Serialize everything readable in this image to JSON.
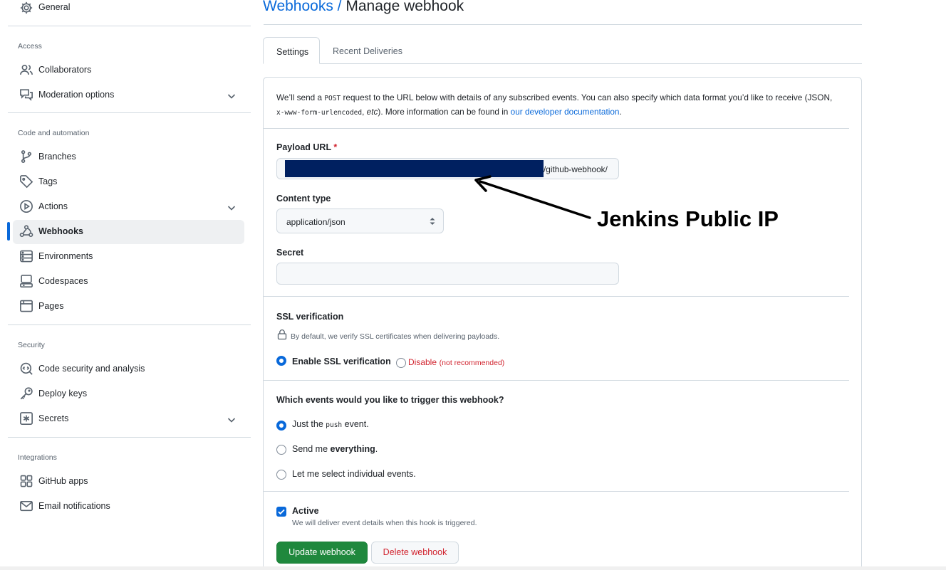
{
  "sidebar": {
    "general": "General",
    "access_heading": "Access",
    "collaborators": "Collaborators",
    "moderation": "Moderation options",
    "code_heading": "Code and automation",
    "branches": "Branches",
    "tags": "Tags",
    "actions": "Actions",
    "webhooks": "Webhooks",
    "environments": "Environments",
    "codespaces": "Codespaces",
    "pages": "Pages",
    "security_heading": "Security",
    "code_security": "Code security and analysis",
    "deploy_keys": "Deploy keys",
    "secrets": "Secrets",
    "integrations_heading": "Integrations",
    "github_apps": "GitHub apps",
    "email_notifications": "Email notifications"
  },
  "header": {
    "breadcrumb_link": "Webhooks",
    "separator": " / ",
    "title": "Manage webhook"
  },
  "tabs": {
    "settings": "Settings",
    "recent_deliveries": "Recent Deliveries"
  },
  "intro": {
    "part1": "We’ll send a ",
    "post": "POST",
    "part2": " request to the URL below with details of any subscribed events. You can also specify which data format you’d like to receive (JSON,",
    "urlencoded": "x-www-form-urlencoded",
    "comma": ", ",
    "etc": "etc",
    "part3": "). More information can be found in ",
    "doc_link": "our developer documentation",
    "period": "."
  },
  "payload": {
    "label": "Payload URL",
    "required_mark": "*",
    "visible_suffix": "/github-webhook/"
  },
  "annotation": {
    "text": "Jenkins Public IP"
  },
  "content_type": {
    "label": "Content type",
    "value": "application/json"
  },
  "secret": {
    "label": "Secret",
    "value": ""
  },
  "ssl": {
    "label": "SSL verification",
    "note": "By default, we verify SSL certificates when delivering payloads.",
    "enable": "Enable SSL verification",
    "disable": "Disable",
    "not_recommended": "(not recommended)"
  },
  "events": {
    "question": "Which events would you like to trigger this webhook?",
    "just_push_pre": "Just the ",
    "push": "push",
    "just_push_post": " event.",
    "send_me_pre": "Send me ",
    "everything": "everything",
    "send_me_post": ".",
    "select_individual": "Let me select individual events."
  },
  "active": {
    "label": "Active",
    "note": "We will deliver event details when this hook is triggered."
  },
  "buttons": {
    "update": "Update webhook",
    "delete": "Delete webhook"
  },
  "colors": {
    "link_blue": "#0969da",
    "danger_red": "#d1242f",
    "primary_green": "#1f883d",
    "redaction_navy": "#002060"
  }
}
